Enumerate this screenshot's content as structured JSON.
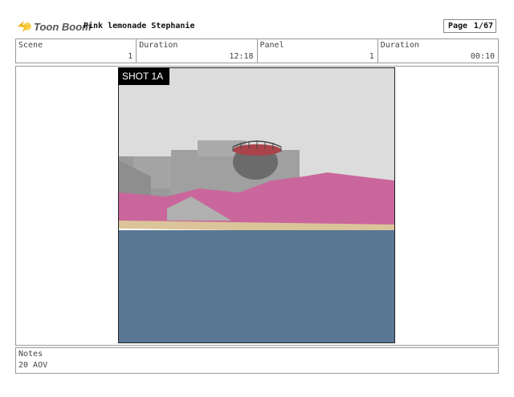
{
  "header": {
    "logo_text": "Toon Boom",
    "project_title": "Pink lemonade Stephanie",
    "page_label": "Page",
    "page_number": "1/67"
  },
  "info": {
    "scene_label": "Scene",
    "scene_value": "1",
    "scene_duration_label": "Duration",
    "scene_duration_value": "12:18",
    "panel_label": "Panel",
    "panel_value": "1",
    "panel_duration_label": "Duration",
    "panel_duration_value": "00:10"
  },
  "panel": {
    "shot_label": "SHOT 1A",
    "colors": {
      "sky": "#dcdcdc",
      "building": "#9a9a9a",
      "hills": "#c9679c",
      "sand": "#dcc49a",
      "water": "#5a7894"
    }
  },
  "notes": {
    "label": "Notes",
    "text": "20 AOV"
  }
}
